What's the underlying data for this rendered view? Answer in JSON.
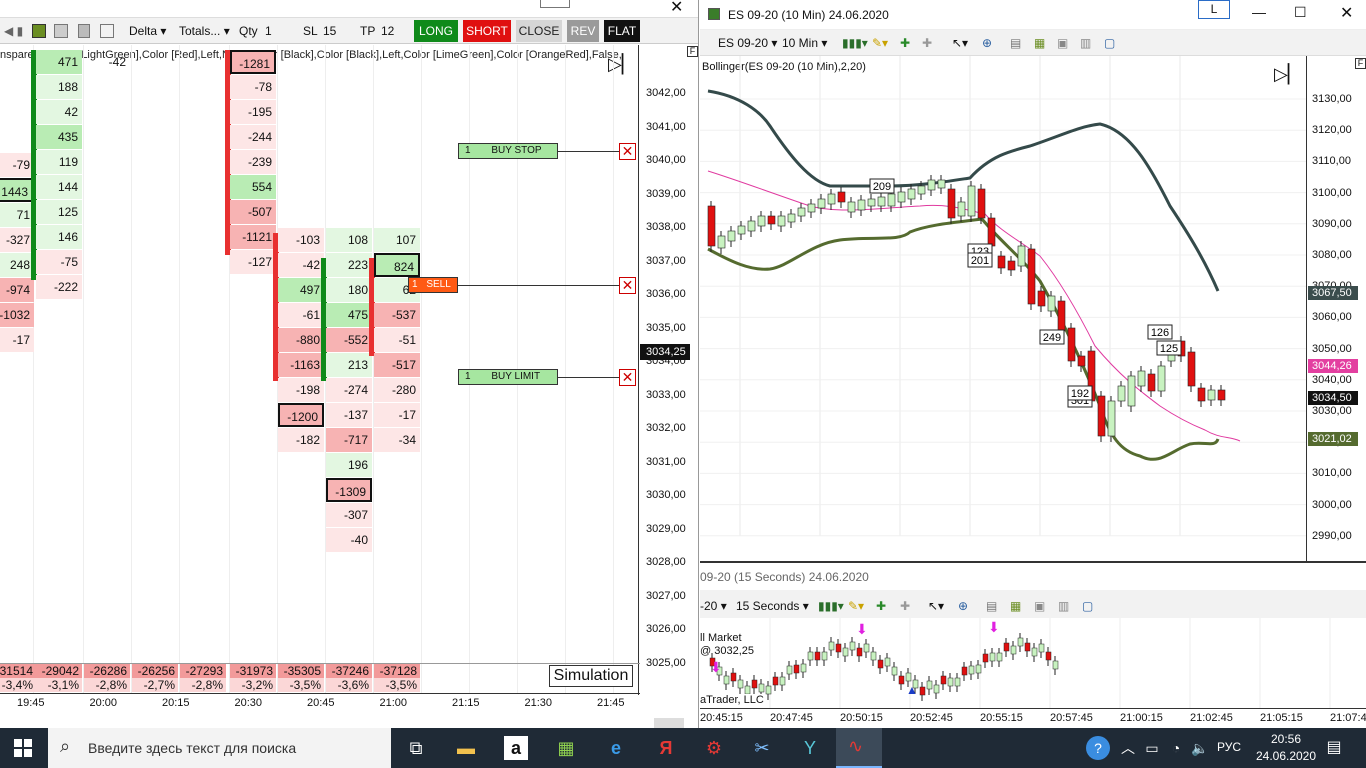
{
  "left_window": {
    "toolbar": {
      "mode": "Delta",
      "totals": "Totals...",
      "qty_label": "Qty",
      "qty_value": "1",
      "sl_label": "SL",
      "sl_value": "15",
      "tp_label": "TP",
      "tp_value": "12",
      "long_label": "LONG",
      "short_label": "SHORT",
      "close_label": "CLOSE",
      "rev_label": "REV",
      "flat_label": "FLAT",
      "colors": {
        "long": "#0f8a1a",
        "short": "#e01010",
        "close": "#d6d6d6",
        "rev": "#9a9a9a",
        "flat": "#111111"
      }
    },
    "header_text": "nsparent],Color [LightGreen],Color [Red],Left,None,Color [Black],Color [Black],Left,Color [LimeGreen],Color [OrangeRed],False,",
    "price_axis": [
      "3042,00",
      "3041,00",
      "3040,00",
      "3039,00",
      "3038,00",
      "3037,00",
      "3036,00",
      "3035,00",
      "3034,00",
      "3033,00",
      "3032,00",
      "3031,00",
      "3030,00",
      "3029,00",
      "3028,00",
      "3027,00",
      "3026,00",
      "3025,00"
    ],
    "current_price": "3034,25",
    "orders": {
      "buy_stop_qty": "1",
      "buy_stop_label": "BUY STOP",
      "sell_qty": "1",
      "sell_label": "SELL",
      "buy_limit_qty": "1",
      "buy_limit_label": "BUY LIMIT"
    },
    "columns": [
      {
        "cells": [
          "-79",
          "1443",
          "71",
          "-327",
          "248",
          "-974",
          "-1032",
          "-17"
        ]
      },
      {
        "cells": [
          "471",
          "188",
          "42",
          "435",
          "119",
          "144",
          "125",
          "146",
          "-75",
          "-222"
        ]
      },
      {
        "cells": [
          "-42"
        ]
      },
      {
        "cells": [
          "-1281",
          "-78",
          "-195",
          "-244",
          "-239",
          "554",
          "-507",
          "-1121",
          "-127"
        ]
      },
      {
        "cells": [
          "-103",
          "-42",
          "497",
          "-61",
          "-880",
          "-1163",
          "-198",
          "-1200",
          "-182"
        ]
      },
      {
        "cells": [
          "108",
          "223",
          "180",
          "475",
          "-552",
          "213",
          "-274",
          "-137",
          "-717",
          "196",
          "-1309",
          "-307",
          "-40"
        ]
      },
      {
        "cells": [
          "107",
          "824",
          "62",
          "-537",
          "-51",
          "-517",
          "-280",
          "-17",
          "-34"
        ]
      }
    ],
    "totals_row": [
      "31514",
      "-29042",
      "-26286",
      "-26256",
      "-27293",
      "-31973",
      "-35305",
      "-37246",
      "-37128"
    ],
    "pct_row": [
      "-3,4%",
      "-3,1%",
      "-2,8%",
      "-2,7%",
      "-2,8%",
      "-3,2%",
      "-3,5%",
      "-3,6%",
      "-3,5%"
    ],
    "simulation_label": "Simulation",
    "time_axis": [
      "19:45",
      "20:00",
      "20:15",
      "20:30",
      "20:45",
      "21:00",
      "21:15",
      "21:30",
      "21:45"
    ],
    "f_marker": "F"
  },
  "right_window": {
    "title": "ES 09-20 (10 Min)  24.06.2020",
    "l_button": "L",
    "instrument": "ES 09-20",
    "interval": "10 Min",
    "indicator_label": "Bollinger(ES 09-20 (10 Min),2,20)",
    "price_axis": [
      "3130,00",
      "3120,00",
      "3110,00",
      "3100,00",
      "3090,00",
      "3080,00",
      "3070,00",
      "3060,00",
      "3050,00",
      "3040,00",
      "3030,00",
      "3020,00",
      "3010,00",
      "3000,00",
      "2990,00"
    ],
    "price_tags": [
      {
        "value": "3067,50",
        "color": "#3b4d4d"
      },
      {
        "value": "3044,26",
        "color": "#e33fa0"
      },
      {
        "value": "3034,50",
        "color": "#111111"
      },
      {
        "value": "3021,02",
        "color": "#556b2f"
      }
    ],
    "bar_labels": [
      "209",
      "123",
      "201",
      "249",
      "126",
      "125",
      "301",
      "192"
    ],
    "f_marker": "F",
    "lower_title": "09-20 (15 Seconds)  24.06.2020",
    "lower_instrument": "-20",
    "lower_interval": "15 Seconds",
    "lower_market_label": "ll Market",
    "lower_price": "@ 3032,25",
    "lower_trader": "aTrader, LLC",
    "lower_time_axis": [
      "20:45:15",
      "20:47:45",
      "20:50:15",
      "20:52:45",
      "20:55:15",
      "20:57:45",
      "21:00:15",
      "21:02:45",
      "21:05:15",
      "21:07:4"
    ]
  },
  "taskbar": {
    "search_placeholder": "Введите здесь текст для поиска",
    "language": "РУС",
    "time": "20:56",
    "date": "24.06.2020"
  }
}
